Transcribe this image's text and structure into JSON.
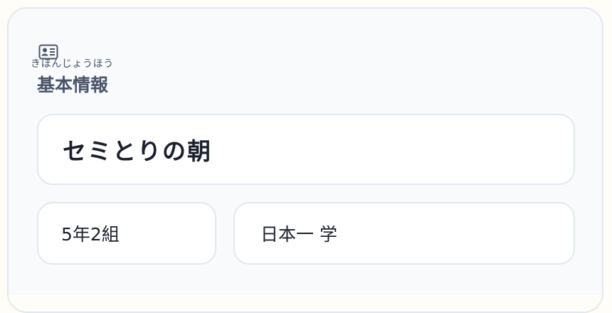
{
  "section": {
    "icon": "id-card-icon",
    "ruby": "きほんじょうほう",
    "title": "基本情報"
  },
  "fields": {
    "story_title": "セミとりの朝",
    "class_name": "5年2組",
    "student_name": "日本一 学"
  },
  "colors": {
    "card_background": "#f8fafc",
    "border": "#e2e8f0",
    "heading_text": "#4a5568",
    "field_text": "#1a202c"
  }
}
